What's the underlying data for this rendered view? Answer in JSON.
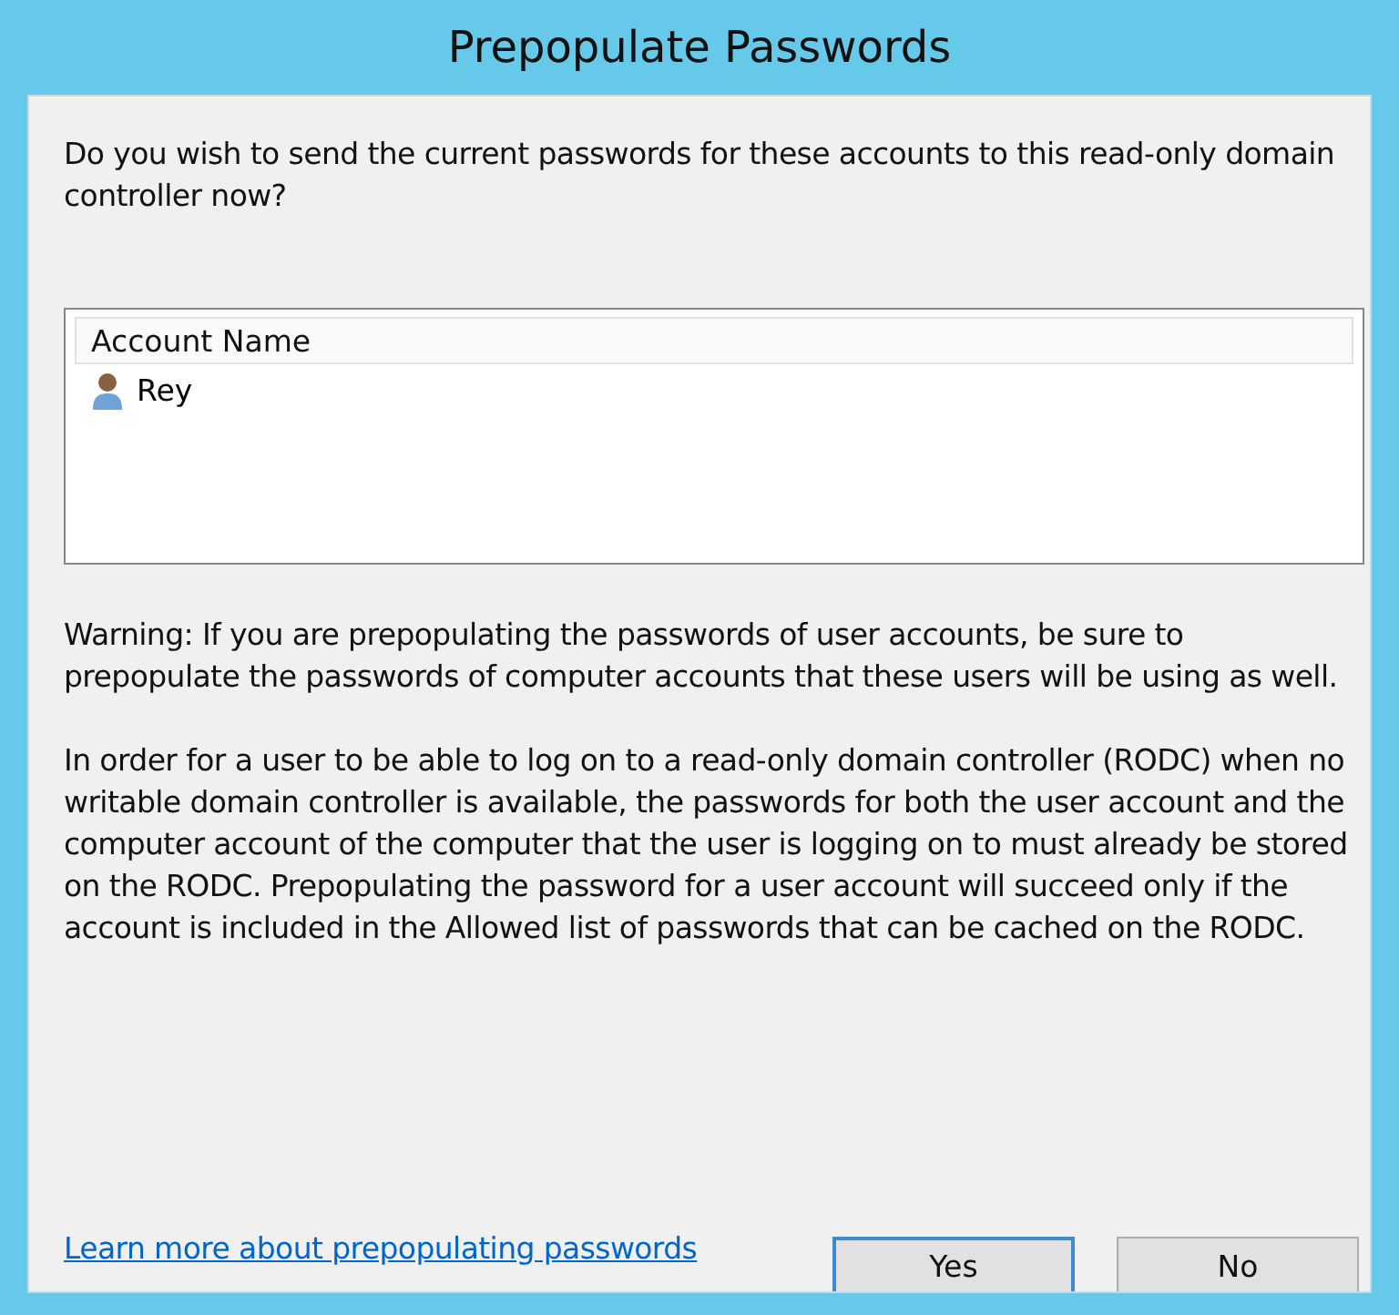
{
  "window": {
    "title": "Prepopulate Passwords"
  },
  "question": "Do you wish to send the current passwords for these accounts to this read-only domain controller now?",
  "accounts": {
    "columns": [
      "Account Name"
    ],
    "rows": [
      {
        "name": "Rey",
        "selected": false
      }
    ]
  },
  "warning": "Warning: If you are prepopulating the passwords of user accounts, be sure to prepopulate the passwords of computer accounts that these users will be using as well.",
  "explanation": "In order for a user to be able to log on to a read-only domain controller (RODC) when no writable domain controller is available, the passwords for both the user account and the computer account of the computer that the user is logging on to must already be stored on the RODC. Prepopulating the password for a user account will succeed only if the account is included in the Allowed list of passwords that can be cached on the RODC.",
  "link": "Learn more about prepopulating passwords",
  "buttons": [
    {
      "label": "Yes",
      "default": true
    },
    {
      "label": "No",
      "default": false
    }
  ]
}
